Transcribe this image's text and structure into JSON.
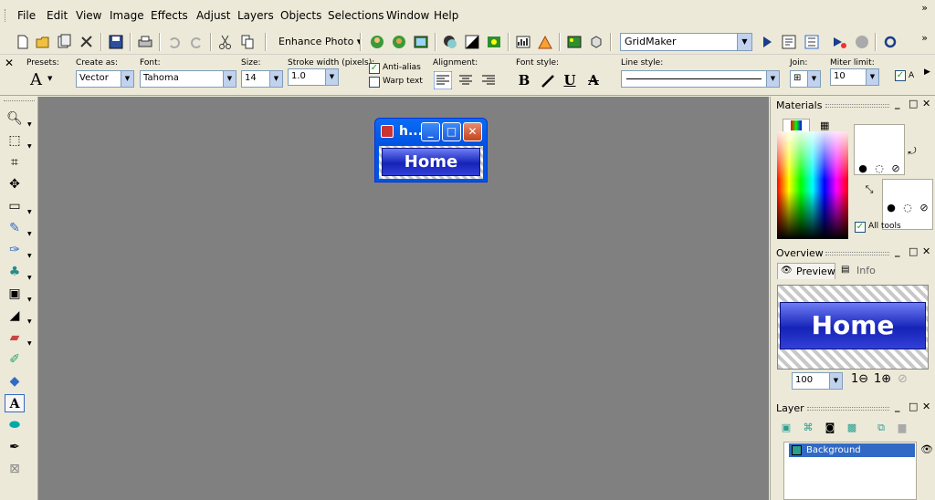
{
  "menu": {
    "items": [
      "File",
      "Edit",
      "View",
      "Image",
      "Effects",
      "Adjust",
      "Layers",
      "Objects",
      "Selections",
      "Window",
      "Help"
    ],
    "more": "»"
  },
  "toolbar": {
    "enhance_label": "Enhance Photo ▾",
    "script_combo": "GridMaker"
  },
  "options": {
    "presets_label": "Presets:",
    "create_as_label": "Create as:",
    "create_as_value": "Vector",
    "font_label": "Font:",
    "font_value": "Tahoma",
    "size_label": "Size:",
    "size_value": "14",
    "stroke_label": "Stroke width (pixels):",
    "stroke_value": "1.0",
    "antialias_label": "Anti-alias",
    "warp_label": "Warp text",
    "alignment_label": "Alignment:",
    "font_style_label": "Font style:",
    "line_style_label": "Line style:",
    "join_label": "Join:",
    "miter_label": "Miter limit:",
    "miter_value": "10",
    "apply_label": "A",
    "bold": "B",
    "underline": "U",
    "strike": "A"
  },
  "image_window": {
    "title": "h...",
    "button_text": "Home"
  },
  "materials": {
    "title": "Materials",
    "all_tools_label": "All tools"
  },
  "overview": {
    "title": "Overview",
    "tab_preview": "Preview",
    "tab_info": "Info",
    "zoom_value": "100",
    "preview_text": "Home"
  },
  "layer": {
    "title": "Layer",
    "row_name": "Background"
  }
}
